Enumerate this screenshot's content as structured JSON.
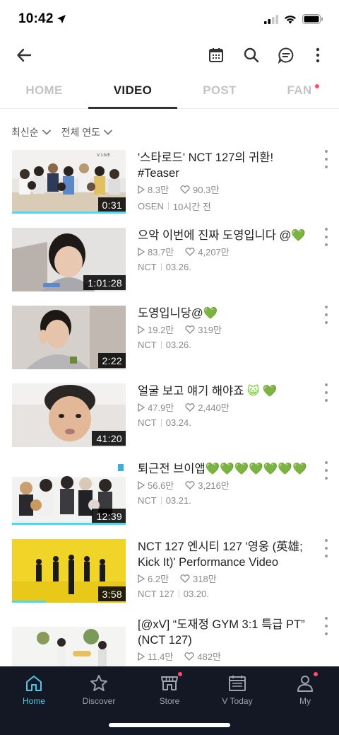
{
  "status_bar": {
    "time": "10:42"
  },
  "tabs": [
    {
      "label": "HOME",
      "active": false
    },
    {
      "label": "VIDEO",
      "active": true
    },
    {
      "label": "POST",
      "active": false
    },
    {
      "label": "FAN",
      "active": false,
      "badge": true
    }
  ],
  "filters": {
    "sort": "최신순",
    "year": "전체 연도"
  },
  "videos": [
    {
      "title": "'스타로드' NCT 127의 귀환! #Teaser",
      "views": "8.3만",
      "likes": "90.3만",
      "channel": "OSEN",
      "date": "10시간 전",
      "duration": "0:31",
      "watched": 1.0
    },
    {
      "title": "으악 이번에 진짜 도영입니다 @",
      "title_emoji": "💚",
      "views": "83.7만",
      "likes": "4,207만",
      "channel": "NCT",
      "date": "03.26.",
      "duration": "1:01:28",
      "watched": 0
    },
    {
      "title": "도영입니당@",
      "title_emoji": "💚",
      "views": "19.2만",
      "likes": "319만",
      "channel": "NCT",
      "date": "03.26.",
      "duration": "2:22",
      "watched": 0
    },
    {
      "title": "얼굴 보고 얘기 해야죠",
      "title_emoji": "😺 💚",
      "views": "47.9만",
      "likes": "2,440만",
      "channel": "NCT",
      "date": "03.24.",
      "duration": "41:20",
      "watched": 0
    },
    {
      "title": "퇴근전 브이앱",
      "title_emoji": "💚💚💚💚💚💚💚",
      "views": "56.6만",
      "likes": "3,216만",
      "channel": "NCT",
      "date": "03.21.",
      "duration": "12:39",
      "watched": 1.0
    },
    {
      "title": "NCT 127 엔시티 127 '영웅 (英雄; Kick It)' Performance Video",
      "views": "6.2만",
      "likes": "318만",
      "channel": "NCT 127",
      "date": "03.20.",
      "duration": "3:58",
      "watched": 0.3
    },
    {
      "title": "[@xV] “도재정 GYM 3:1 특급 PT” (NCT 127)",
      "views": "11.4만",
      "likes": "482만",
      "channel": "",
      "date": "",
      "duration": "",
      "watched": 0
    }
  ],
  "bottom_nav": [
    {
      "label": "Home",
      "icon": "home-icon",
      "active": true
    },
    {
      "label": "Discover",
      "icon": "star-icon",
      "active": false
    },
    {
      "label": "Store",
      "icon": "store-icon",
      "active": false,
      "badge": true
    },
    {
      "label": "V Today",
      "icon": "calendar-today-icon",
      "active": false
    },
    {
      "label": "My",
      "icon": "user-icon",
      "active": false,
      "badge": true
    }
  ],
  "colors": {
    "accent": "#4fc9e8",
    "heart_green": "#66d11a",
    "badge": "#ff4d6d",
    "nav_bg": "#141824"
  }
}
